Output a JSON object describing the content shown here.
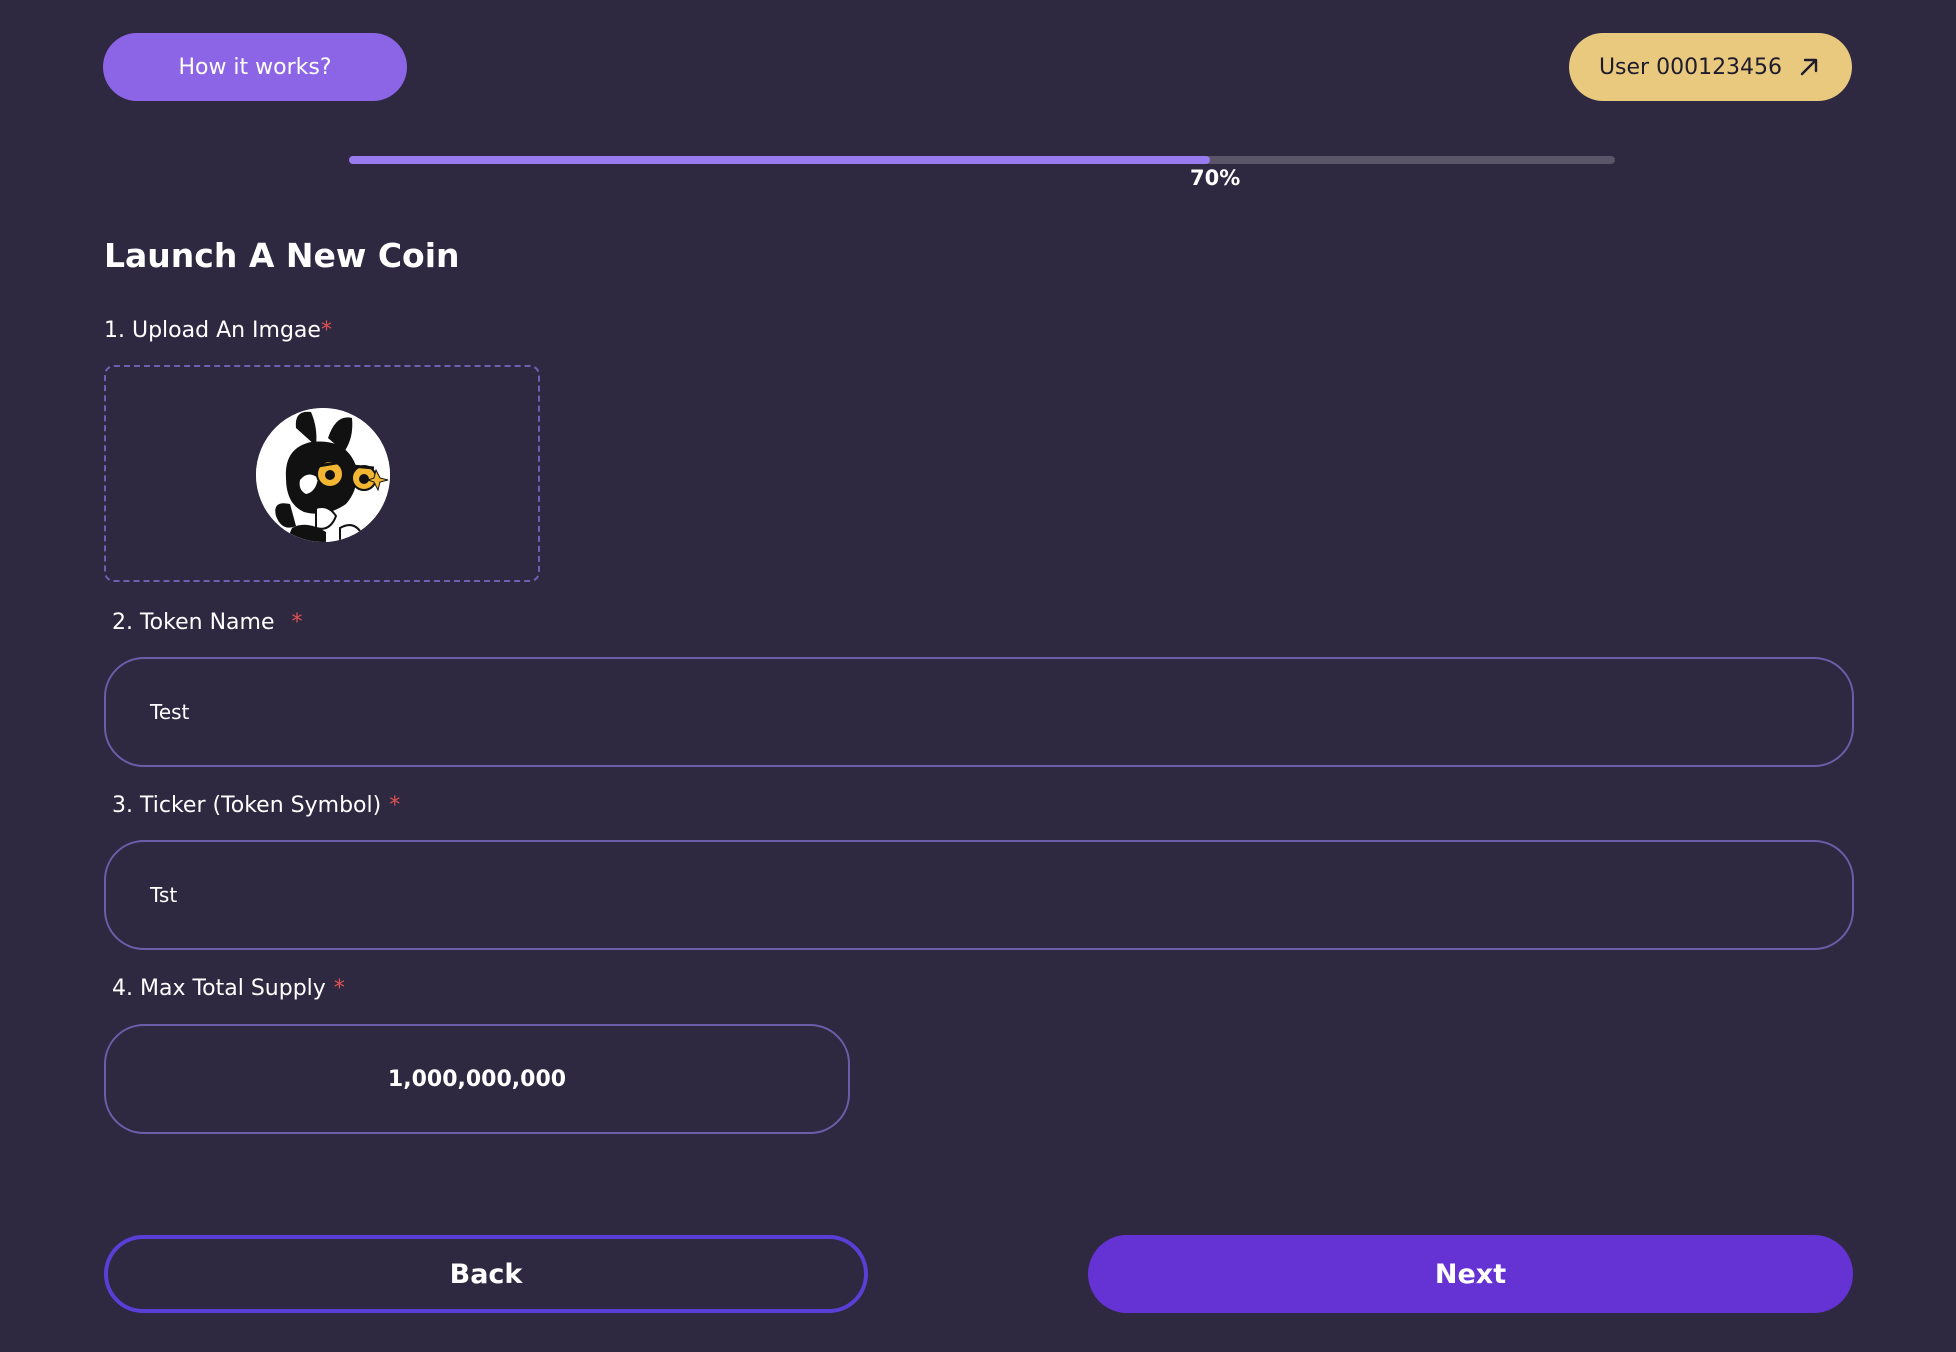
{
  "header": {
    "how_it_works_label": "How it works?",
    "user_label": "User 000123456",
    "user_icon": "arrow-up-right-icon"
  },
  "progress": {
    "percent": 68,
    "label": "70%"
  },
  "form": {
    "title": "Launch A New Coin",
    "upload": {
      "label": "1. Upload An Imgae",
      "required_mark": "*",
      "preview": "cartoon-cat-avatar-image"
    },
    "token_name": {
      "label": "2. Token Name ",
      "required_mark": "*",
      "value": "Test"
    },
    "ticker": {
      "label": "3. Ticker (Token Symbol)",
      "required_mark": "*",
      "value": "Tst"
    },
    "supply": {
      "label": "4. Max Total Supply",
      "required_mark": "*",
      "value": "1,000,000,000"
    }
  },
  "actions": {
    "back_label": "Back",
    "next_label": "Next"
  },
  "colors": {
    "background": "#2e2941",
    "accent_purple": "#8b65e6",
    "user_button": "#e8c97e",
    "next_button": "#6533d4",
    "required": "#e05252"
  }
}
